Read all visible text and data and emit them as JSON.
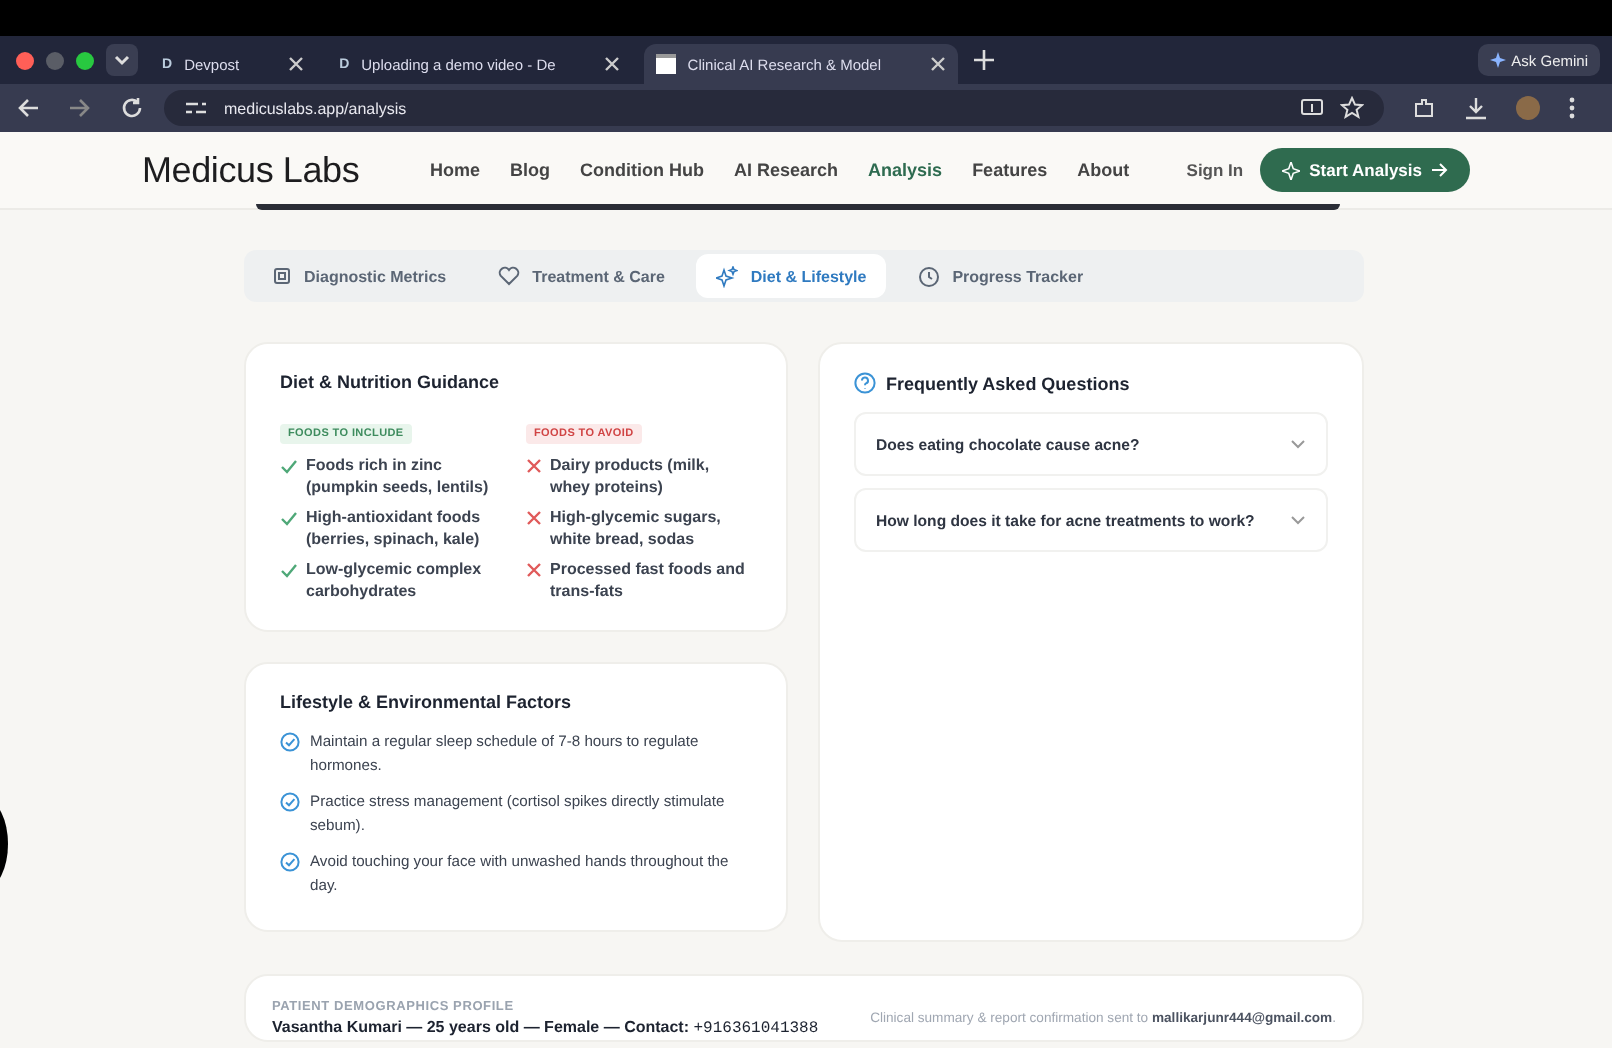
{
  "browser": {
    "tabs": [
      {
        "title": "Devpost",
        "favicon": "D",
        "selected": false
      },
      {
        "title": "Uploading a demo video - De",
        "favicon": "D",
        "selected": false
      },
      {
        "title": "Clinical AI Research & Model",
        "selected": true
      }
    ],
    "ask_button": "Ask Gemini",
    "url": "medicuslabs.app/analysis"
  },
  "site": {
    "logo": "Medicus Labs",
    "nav": [
      {
        "label": "Home",
        "selected": false
      },
      {
        "label": "Blog",
        "selected": false
      },
      {
        "label": "Condition Hub",
        "selected": false
      },
      {
        "label": "AI Research",
        "selected": false
      },
      {
        "label": "Analysis",
        "selected": true
      },
      {
        "label": "Features",
        "selected": false
      },
      {
        "label": "About",
        "selected": false
      }
    ],
    "sign_in": "Sign In",
    "cta": "Start Analysis"
  },
  "section_tabs": [
    {
      "label": "Diagnostic Metrics",
      "selected": false
    },
    {
      "label": "Treatment & Care",
      "selected": false
    },
    {
      "label": "Diet & Lifestyle",
      "selected": true
    },
    {
      "label": "Progress Tracker",
      "selected": false
    }
  ],
  "diet": {
    "title": "Diet & Nutrition Guidance",
    "columns": [
      {
        "heading": "FOODS TO INCLUDE",
        "kind": "include",
        "items": [
          "Foods rich in zinc (pumpkin seeds, lentils)",
          "High-antioxidant foods (berries, spinach, kale)",
          "Low-glycemic complex carbohydrates"
        ]
      },
      {
        "heading": "FOODS TO AVOID",
        "kind": "avoid",
        "items": [
          "Dairy products (milk, whey proteins)",
          "High-glycemic sugars, white bread, sodas",
          "Processed fast foods and trans-fats"
        ]
      }
    ]
  },
  "lifestyle": {
    "title": "Lifestyle & Environmental Factors",
    "items": [
      "Maintain a regular sleep schedule of 7-8 hours to regulate hormones.",
      "Practice stress management (cortisol spikes directly stimulate sebum).",
      "Avoid touching your face with unwashed hands throughout the day."
    ]
  },
  "faq": {
    "title": "Frequently Asked Questions",
    "items": [
      {
        "question": "Does eating chocolate cause acne?",
        "expanded": false
      },
      {
        "question": "How long does it take for acne treatments to work?",
        "expanded": false
      }
    ]
  },
  "profile": {
    "label": "PATIENT DEMOGRAPHICS PROFILE",
    "details": "Vasantha Kumari — 25 years old — Female — Contact:",
    "phone": "+916361041388",
    "note": "Clinical summary & report confirmation sent to **mallikarjunr444@gmail.com**."
  }
}
